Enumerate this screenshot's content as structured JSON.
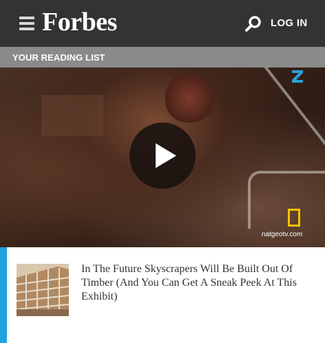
{
  "header": {
    "logo_text": "Forbes",
    "login_label": "LOG IN",
    "menu_icon": "hamburger-menu-icon",
    "search_icon": "search-icon",
    "background_color": "#333333"
  },
  "reading_list": {
    "label": "YOUR READING LIST"
  },
  "video": {
    "watermark": "natgeotv.com",
    "play_icon": "play-icon",
    "channel_icon": "channel-z-icon",
    "brand_icon": "national-geographic-icon",
    "brand_color": "#f5c400"
  },
  "article": {
    "title": "In The Future Skyscrapers Will Be Built Out Of Timber (And You Can Get A Sneak Peek At This Exhibit)",
    "accent_color": "#1fa3de"
  }
}
